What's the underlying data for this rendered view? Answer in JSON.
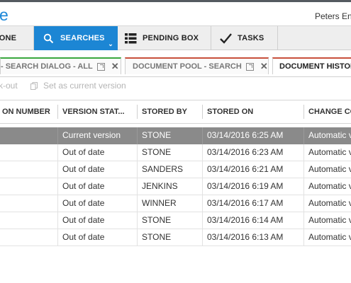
{
  "app": {
    "logo_text": "e",
    "company": "Peters Eng"
  },
  "nav": {
    "home_label": "TONE",
    "searches_label": "SEARCHES",
    "pending_label": "PENDING BOX",
    "tasks_label": "TASKS"
  },
  "tabs": [
    {
      "label": "- SEARCH DIALOG - ALL",
      "accent": "#3aa83f"
    },
    {
      "label": "DOCUMENT POOL - SEARCH",
      "accent": "#c8503c"
    },
    {
      "label": "DOCUMENT HISTOR",
      "accent": "#c8503c"
    }
  ],
  "toolbar": {
    "checkout_label": "k-out",
    "set_current_label": "Set as current version"
  },
  "table": {
    "columns": [
      "ON NUMBER",
      "VERSION STAT...",
      "STORED BY",
      "STORED ON",
      "CHANGE CO"
    ],
    "rows": [
      {
        "status": "Current version",
        "stored_by": "STONE",
        "stored_on": "03/14/2016 6:25 AM",
        "change": "Automatic v",
        "selected": true
      },
      {
        "status": "Out of date",
        "stored_by": "STONE",
        "stored_on": "03/14/2016 6:23 AM",
        "change": "Automatic v",
        "selected": false
      },
      {
        "status": "Out of date",
        "stored_by": "SANDERS",
        "stored_on": "03/14/2016 6:21 AM",
        "change": "Automatic v",
        "selected": false
      },
      {
        "status": "Out of date",
        "stored_by": "JENKINS",
        "stored_on": "03/14/2016 6:19 AM",
        "change": "Automatic v",
        "selected": false
      },
      {
        "status": "Out of date",
        "stored_by": "WINNER",
        "stored_on": "03/14/2016 6:17 AM",
        "change": "Automatic v",
        "selected": false
      },
      {
        "status": "Out of date",
        "stored_by": "STONE",
        "stored_on": "03/14/2016 6:14 AM",
        "change": "Automatic v",
        "selected": false
      },
      {
        "status": "Out of date",
        "stored_by": "STONE",
        "stored_on": "03/14/2016 6:13 AM",
        "change": "Automatic v",
        "selected": false
      }
    ]
  },
  "colors": {
    "accent_blue": "#1c86d4",
    "selected_row": "#8a8a8a"
  }
}
